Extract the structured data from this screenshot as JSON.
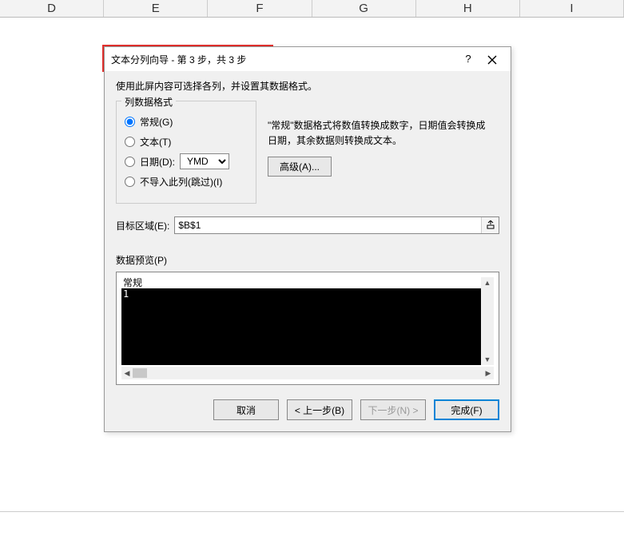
{
  "columns": [
    "D",
    "E",
    "F",
    "G",
    "H",
    "I"
  ],
  "dialog": {
    "title": "文本分列向导 - 第 3 步，共 3 步",
    "help_label": "?",
    "hint": "使用此屏内容可选择各列，并设置其数据格式。",
    "format_legend": "列数据格式",
    "radios": {
      "general": "常规(G)",
      "text": "文本(T)",
      "date": "日期(D):",
      "skip": "不导入此列(跳过)(I)"
    },
    "date_format": "YMD",
    "desc": "\"常规\"数据格式将数值转换成数字，日期值会转换成日期，其余数据则转换成文本。",
    "advanced_label": "高级(A)...",
    "target_label": "目标区域(E):",
    "target_value": "$B$1",
    "preview_label": "数据预览(P)",
    "preview_header": "常规",
    "preview_row1": "1",
    "buttons": {
      "cancel": "取消",
      "back": "< 上一步(B)",
      "next": "下一步(N) >",
      "finish": "完成(F)"
    }
  }
}
